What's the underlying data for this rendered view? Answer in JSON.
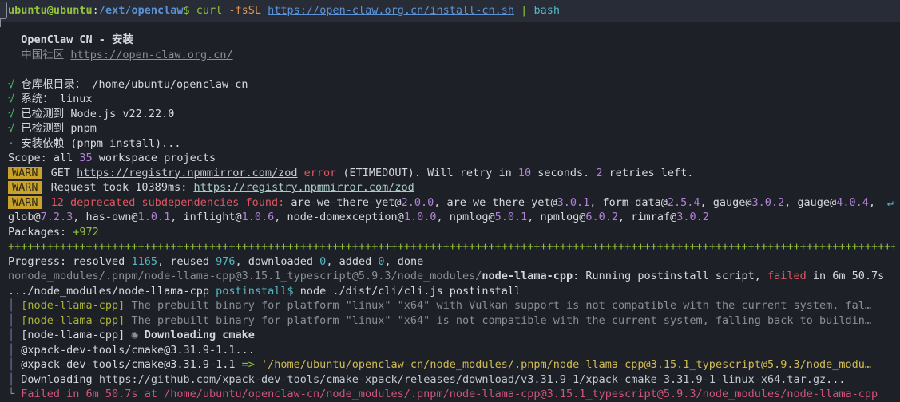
{
  "terminal": {
    "wrap_glyph": "↵",
    "colors": {
      "background": "#1d2127",
      "prompt_strip": "#272c37",
      "foreground": "#d6d8dd",
      "green": "#94c13d",
      "check_green": "#45c26d",
      "blue": "#5b93d6",
      "orange": "#dc9656",
      "cyan": "#56b6c2",
      "purple": "#b180d7",
      "red": "#e05561",
      "yellow": "#d0ba55",
      "warn_badge_bg": "#c9a22b"
    },
    "lines": [
      {
        "name": "prompt-line",
        "segments": [
          {
            "t": "ubuntu@ubuntu",
            "c": "grn b",
            "n": "prompt-user-host"
          },
          {
            "t": ":",
            "c": "fg"
          },
          {
            "t": "/ext/openclaw",
            "c": "blu b",
            "n": "prompt-cwd"
          },
          {
            "t": "$ ",
            "c": "grn"
          },
          {
            "t": "curl ",
            "c": "grn",
            "n": "command"
          },
          {
            "t": "-fsSL ",
            "c": "org",
            "n": "command-flags"
          },
          {
            "t": "https://open-claw.org.cn/install-cn.sh",
            "c": "blu und"
          },
          {
            "t": " ",
            "c": "fg"
          },
          {
            "t": "| ",
            "c": "grn"
          },
          {
            "t": "bash",
            "c": "cyn"
          }
        ]
      },
      {
        "name": "blank-line",
        "segments": []
      },
      {
        "name": "installer-title",
        "segments": [
          {
            "t": "  OpenClaw CN - 安装",
            "c": "fg b"
          }
        ]
      },
      {
        "name": "community-line",
        "segments": [
          {
            "t": "  中国社区 ",
            "c": "gry"
          },
          {
            "t": "https://open-claw.org.cn/",
            "c": "gry und"
          }
        ]
      },
      {
        "name": "blank-line",
        "segments": []
      },
      {
        "name": "check-repo-root",
        "segments": [
          {
            "t": "√ ",
            "c": "grn2",
            "n": "check-icon"
          },
          {
            "t": "仓库根目录： /home/ubuntu/openclaw-cn",
            "c": "fg"
          }
        ]
      },
      {
        "name": "check-system",
        "segments": [
          {
            "t": "√ ",
            "c": "grn2",
            "n": "check-icon"
          },
          {
            "t": "系统： linux",
            "c": "fg"
          }
        ]
      },
      {
        "name": "check-node",
        "segments": [
          {
            "t": "√ ",
            "c": "grn2",
            "n": "check-icon"
          },
          {
            "t": "已检测到 Node.js v22.22.0",
            "c": "fg"
          }
        ]
      },
      {
        "name": "check-pnpm",
        "segments": [
          {
            "t": "√ ",
            "c": "grn2",
            "n": "check-icon"
          },
          {
            "t": "已检测到 pnpm",
            "c": "fg"
          }
        ]
      },
      {
        "name": "install-deps-line",
        "segments": [
          {
            "t": "· ",
            "c": "gry",
            "n": "bullet-icon"
          },
          {
            "t": "安装依赖 (pnpm install)...",
            "c": "fg"
          }
        ]
      },
      {
        "name": "scope-line",
        "segments": [
          {
            "t": "Scope: all ",
            "c": "fg"
          },
          {
            "t": "35",
            "c": "pur"
          },
          {
            "t": " workspace projects",
            "c": "fg"
          }
        ]
      },
      {
        "name": "warn-line-get",
        "segments": [
          {
            "t": "WARN",
            "c": "badge",
            "n": "warn-badge"
          },
          {
            "t": " GET ",
            "c": "fg"
          },
          {
            "t": "https://registry.npmmirror.com/zod",
            "c": "wht und"
          },
          {
            "t": " error",
            "c": "red"
          },
          {
            "t": " (ETIMEDOUT). Will retry in ",
            "c": "fg"
          },
          {
            "t": "10",
            "c": "pur"
          },
          {
            "t": " seconds. ",
            "c": "fg"
          },
          {
            "t": "2",
            "c": "pur"
          },
          {
            "t": " retries left.",
            "c": "fg"
          }
        ]
      },
      {
        "name": "warn-line-request",
        "segments": [
          {
            "t": "WARN",
            "c": "badge",
            "n": "warn-badge"
          },
          {
            "t": " Request took 10389ms: ",
            "c": "fg"
          },
          {
            "t": "https://registry.npmmirror.com/zod",
            "c": "cyn2 und"
          }
        ]
      },
      {
        "name": "warn-line-deprecated",
        "wrap": true,
        "segments": [
          {
            "t": "WARN",
            "c": "badge",
            "n": "warn-badge"
          },
          {
            "t": " ",
            "c": "fg"
          },
          {
            "t": "12 deprecated subdependencies found:",
            "c": "red"
          },
          {
            "t": " are-we-there-yet@",
            "c": "fg"
          },
          {
            "t": "2.0.0",
            "c": "pur"
          },
          {
            "t": ", are-we-there-yet@",
            "c": "fg"
          },
          {
            "t": "3.0.1",
            "c": "pur"
          },
          {
            "t": ", form-data@",
            "c": "fg"
          },
          {
            "t": "2.5.4",
            "c": "pur"
          },
          {
            "t": ", gauge@",
            "c": "fg"
          },
          {
            "t": "3.0.2",
            "c": "pur"
          },
          {
            "t": ", gauge@",
            "c": "fg"
          },
          {
            "t": "4.0.4",
            "c": "pur"
          },
          {
            "t": ",",
            "c": "fg"
          }
        ]
      },
      {
        "name": "deprecated-continued",
        "segments": [
          {
            "t": "glob@",
            "c": "fg"
          },
          {
            "t": "7.2.3",
            "c": "pur"
          },
          {
            "t": ", has-own@",
            "c": "fg"
          },
          {
            "t": "1.0.1",
            "c": "pur"
          },
          {
            "t": ", inflight@",
            "c": "fg"
          },
          {
            "t": "1.0.6",
            "c": "pur"
          },
          {
            "t": ", node-domexception@",
            "c": "fg"
          },
          {
            "t": "1.0.0",
            "c": "pur"
          },
          {
            "t": ", npmlog@",
            "c": "fg"
          },
          {
            "t": "5.0.1",
            "c": "pur"
          },
          {
            "t": ", npmlog@",
            "c": "fg"
          },
          {
            "t": "6.0.2",
            "c": "pur"
          },
          {
            "t": ", rimraf@",
            "c": "fg"
          },
          {
            "t": "3.0.2",
            "c": "pur"
          }
        ]
      },
      {
        "name": "packages-line",
        "segments": [
          {
            "t": "Packages: ",
            "c": "fg"
          },
          {
            "t": "+972",
            "c": "grn"
          }
        ]
      },
      {
        "name": "packages-progress-bar",
        "segments": [
          {
            "t": "+++++++++++++++++++++++++++++++++++++++++++++++++++++++++++++++++++++++++++++++++++++++++++++++++++++++++++++++++++++++++++++++++++++++++++",
            "c": "grn",
            "n": "progress-plus-row"
          }
        ]
      },
      {
        "name": "progress-line",
        "segments": [
          {
            "t": "Progress: resolved ",
            "c": "fg"
          },
          {
            "t": "1165",
            "c": "cyn"
          },
          {
            "t": ", reused ",
            "c": "fg"
          },
          {
            "t": "976",
            "c": "cyn"
          },
          {
            "t": ", downloaded ",
            "c": "fg"
          },
          {
            "t": "0",
            "c": "cyn"
          },
          {
            "t": ", added ",
            "c": "fg"
          },
          {
            "t": "0",
            "c": "cyn"
          },
          {
            "t": ", done",
            "c": "fg"
          }
        ]
      },
      {
        "name": "postinstall-status-line",
        "segments": [
          {
            "t": "nonode_modules/.pnpm/node-llama-cpp@3.15.1_typescript@5.9.3/node_modules/",
            "c": "gry"
          },
          {
            "t": "node-llama-cpp",
            "c": "fg b"
          },
          {
            "t": ": Running postinstall script, ",
            "c": "fg"
          },
          {
            "t": "failed",
            "c": "red"
          },
          {
            "t": " in 6m 50.7s",
            "c": "fg"
          }
        ]
      },
      {
        "name": "postinstall-command-line",
        "segments": [
          {
            "t": ".../node_modules/node-llama-cpp ",
            "c": "fg"
          },
          {
            "t": "postinstall$",
            "c": "cyn"
          },
          {
            "t": " node ./dist/cli/cli.js postinstall",
            "c": "fg"
          }
        ]
      },
      {
        "name": "llama-log-vulkan",
        "segments": [
          {
            "t": "│ ",
            "c": "pur2",
            "n": "pipe-bar"
          },
          {
            "t": "[node-llama-cpp]",
            "c": "yel2"
          },
          {
            "t": " The prebuilt binary for platform \"linux\" \"x64\" with Vulkan support is not compatible with the current system, fal…",
            "c": "gry"
          }
        ]
      },
      {
        "name": "llama-log-incompatible",
        "segments": [
          {
            "t": "│ ",
            "c": "pur2",
            "n": "pipe-bar"
          },
          {
            "t": "[node-llama-cpp]",
            "c": "yel2"
          },
          {
            "t": " The prebuilt binary for platform \"linux\" \"x64\" is not compatible with the current system, falling back to buildin…",
            "c": "gry"
          }
        ]
      },
      {
        "name": "llama-log-downloading-cmake",
        "segments": [
          {
            "t": "│ ",
            "c": "pur2",
            "n": "pipe-bar"
          },
          {
            "t": "[node-llama-cpp] ",
            "c": "fg"
          },
          {
            "t": "◉ ",
            "c": "gry",
            "n": "spinner-icon"
          },
          {
            "t": "Downloading cmake",
            "c": "fg b"
          }
        ]
      },
      {
        "name": "xpack-cmake-line",
        "segments": [
          {
            "t": "│ ",
            "c": "pur2",
            "n": "pipe-bar"
          },
          {
            "t": "@xpack-dev-tools/cmake@3.31.9-1.1...",
            "c": "fg"
          }
        ]
      },
      {
        "name": "xpack-cmake-path-line",
        "segments": [
          {
            "t": "│ ",
            "c": "pur2",
            "n": "pipe-bar"
          },
          {
            "t": "@xpack-dev-tools/cmake@3.31.9-1.1 ",
            "c": "fg"
          },
          {
            "t": "=> ",
            "c": "grn"
          },
          {
            "t": "'/home/ubuntu/openclaw-cn/node_modules/.pnpm/node-llama-cpp@3.15.1_typescript@5.9.3/node_modu…",
            "c": "yel"
          }
        ]
      },
      {
        "name": "download-url-line",
        "segments": [
          {
            "t": "│ ",
            "c": "pur2",
            "n": "pipe-bar"
          },
          {
            "t": "Downloading ",
            "c": "fg"
          },
          {
            "t": "https://github.com/xpack-dev-tools/cmake-xpack/releases/download/v3.31.9-1/xpack-cmake-3.31.9-1-linux-x64.tar.gz",
            "c": "wht und"
          },
          {
            "t": "...",
            "c": "fg"
          }
        ]
      },
      {
        "name": "failed-line",
        "segments": [
          {
            "t": "└ ",
            "c": "gry",
            "n": "corner-bar"
          },
          {
            "t": "Failed in 6m 50.7s at /home/ubuntu/openclaw-cn/node_modules/.pnpm/node-llama-cpp@3.15.1_typescript@5.9.3/node_modules/node-llama-cpp",
            "c": "red2"
          }
        ]
      }
    ]
  }
}
